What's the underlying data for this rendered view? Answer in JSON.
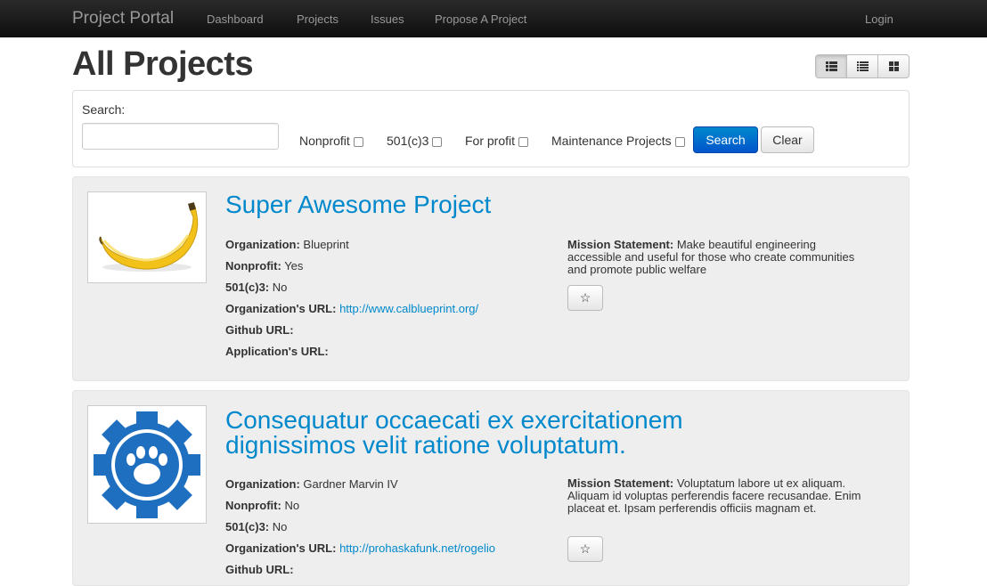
{
  "navbar": {
    "brand": "Project Portal",
    "links": [
      "Dashboard",
      "Projects",
      "Issues",
      "Propose A Project"
    ],
    "login": "Login"
  },
  "page": {
    "title": "All Projects"
  },
  "view_toggle": [
    "details-list-icon",
    "list-icon",
    "grid-icon"
  ],
  "search": {
    "label": "Search:",
    "value": "",
    "filters": [
      "Nonprofit",
      "501(c)3",
      "For profit",
      "Maintenance Projects"
    ],
    "search_button": "Search",
    "clear_button": "Clear"
  },
  "labels": {
    "organization": "Organization:",
    "nonprofit": "Nonprofit:",
    "c3": "501(c)3:",
    "org_url": "Organization's URL:",
    "github_url": "Github URL:",
    "app_url": "Application's URL:",
    "mission": "Mission Statement:"
  },
  "projects": [
    {
      "title": "Super Awesome Project",
      "organization": "Blueprint",
      "nonprofit": "Yes",
      "c3": "No",
      "org_url": "http://www.calblueprint.org/",
      "github_url": "",
      "app_url": "",
      "mission": "Make beautiful engineering accessible and useful for those who create communities and promote public welfare",
      "star": "☆"
    },
    {
      "title": "Consequatur occaecati ex exercitationem dignissimos velit ratione voluptatum.",
      "organization": "Gardner Marvin IV",
      "nonprofit": "No",
      "c3": "No",
      "org_url": "http://prohaskafunk.net/rogelio",
      "github_url": "",
      "mission": "Voluptatum labore ut ex aliquam. Aliquam id voluptas perferendis facere recusandae. Enim placeat et. Ipsam perferendis officiis magnam et.",
      "star": "☆"
    }
  ],
  "colors": {
    "link": "#0088cc",
    "primary_button": "#0066cc",
    "navbar": "#1b1b1b",
    "card_bg": "#eeeeee"
  }
}
